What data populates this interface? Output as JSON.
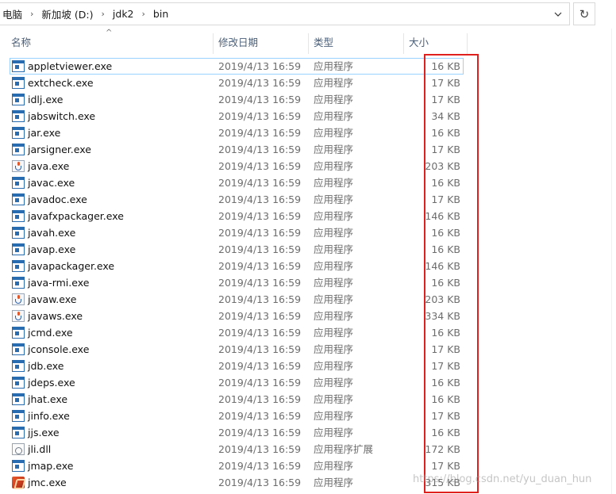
{
  "breadcrumb": {
    "items": [
      "电脑",
      "新加坡 (D:)",
      "jdk2",
      "bin"
    ]
  },
  "columns": {
    "name": "名称",
    "date": "修改日期",
    "type": "类型",
    "size": "大小"
  },
  "files": [
    {
      "name": "appletviewer.exe",
      "date": "2019/4/13 16:59",
      "type": "应用程序",
      "size": "16 KB",
      "icon": "exe-icon"
    },
    {
      "name": "extcheck.exe",
      "date": "2019/4/13 16:59",
      "type": "应用程序",
      "size": "17 KB",
      "icon": "exe-icon"
    },
    {
      "name": "idlj.exe",
      "date": "2019/4/13 16:59",
      "type": "应用程序",
      "size": "17 KB",
      "icon": "exe-icon"
    },
    {
      "name": "jabswitch.exe",
      "date": "2019/4/13 16:59",
      "type": "应用程序",
      "size": "34 KB",
      "icon": "exe-icon"
    },
    {
      "name": "jar.exe",
      "date": "2019/4/13 16:59",
      "type": "应用程序",
      "size": "16 KB",
      "icon": "exe-icon"
    },
    {
      "name": "jarsigner.exe",
      "date": "2019/4/13 16:59",
      "type": "应用程序",
      "size": "17 KB",
      "icon": "exe-icon"
    },
    {
      "name": "java.exe",
      "date": "2019/4/13 16:59",
      "type": "应用程序",
      "size": "203 KB",
      "icon": "java-icon"
    },
    {
      "name": "javac.exe",
      "date": "2019/4/13 16:59",
      "type": "应用程序",
      "size": "16 KB",
      "icon": "exe-icon"
    },
    {
      "name": "javadoc.exe",
      "date": "2019/4/13 16:59",
      "type": "应用程序",
      "size": "17 KB",
      "icon": "exe-icon"
    },
    {
      "name": "javafxpackager.exe",
      "date": "2019/4/13 16:59",
      "type": "应用程序",
      "size": "146 KB",
      "icon": "exe-icon"
    },
    {
      "name": "javah.exe",
      "date": "2019/4/13 16:59",
      "type": "应用程序",
      "size": "16 KB",
      "icon": "exe-icon"
    },
    {
      "name": "javap.exe",
      "date": "2019/4/13 16:59",
      "type": "应用程序",
      "size": "16 KB",
      "icon": "exe-icon"
    },
    {
      "name": "javapackager.exe",
      "date": "2019/4/13 16:59",
      "type": "应用程序",
      "size": "146 KB",
      "icon": "exe-icon"
    },
    {
      "name": "java-rmi.exe",
      "date": "2019/4/13 16:59",
      "type": "应用程序",
      "size": "16 KB",
      "icon": "exe-icon"
    },
    {
      "name": "javaw.exe",
      "date": "2019/4/13 16:59",
      "type": "应用程序",
      "size": "203 KB",
      "icon": "java-icon"
    },
    {
      "name": "javaws.exe",
      "date": "2019/4/13 16:59",
      "type": "应用程序",
      "size": "334 KB",
      "icon": "java-icon"
    },
    {
      "name": "jcmd.exe",
      "date": "2019/4/13 16:59",
      "type": "应用程序",
      "size": "16 KB",
      "icon": "exe-icon"
    },
    {
      "name": "jconsole.exe",
      "date": "2019/4/13 16:59",
      "type": "应用程序",
      "size": "17 KB",
      "icon": "exe-icon"
    },
    {
      "name": "jdb.exe",
      "date": "2019/4/13 16:59",
      "type": "应用程序",
      "size": "17 KB",
      "icon": "exe-icon"
    },
    {
      "name": "jdeps.exe",
      "date": "2019/4/13 16:59",
      "type": "应用程序",
      "size": "16 KB",
      "icon": "exe-icon"
    },
    {
      "name": "jhat.exe",
      "date": "2019/4/13 16:59",
      "type": "应用程序",
      "size": "16 KB",
      "icon": "exe-icon"
    },
    {
      "name": "jinfo.exe",
      "date": "2019/4/13 16:59",
      "type": "应用程序",
      "size": "17 KB",
      "icon": "exe-icon"
    },
    {
      "name": "jjs.exe",
      "date": "2019/4/13 16:59",
      "type": "应用程序",
      "size": "16 KB",
      "icon": "exe-icon"
    },
    {
      "name": "jli.dll",
      "date": "2019/4/13 16:59",
      "type": "应用程序扩展",
      "size": "172 KB",
      "icon": "dll-icon"
    },
    {
      "name": "jmap.exe",
      "date": "2019/4/13 16:59",
      "type": "应用程序",
      "size": "17 KB",
      "icon": "exe-icon"
    },
    {
      "name": "jmc.exe",
      "date": "2019/4/13 16:59",
      "type": "应用程序",
      "size": "315 KB",
      "icon": "jmc-icon"
    }
  ],
  "selected_index": 0,
  "watermark": "https://blog.csdn.net/yu_duan_hun",
  "colors": {
    "annotation_red": "#e0201c",
    "selection_border": "#99d1ff",
    "header_text": "#4c607a"
  }
}
